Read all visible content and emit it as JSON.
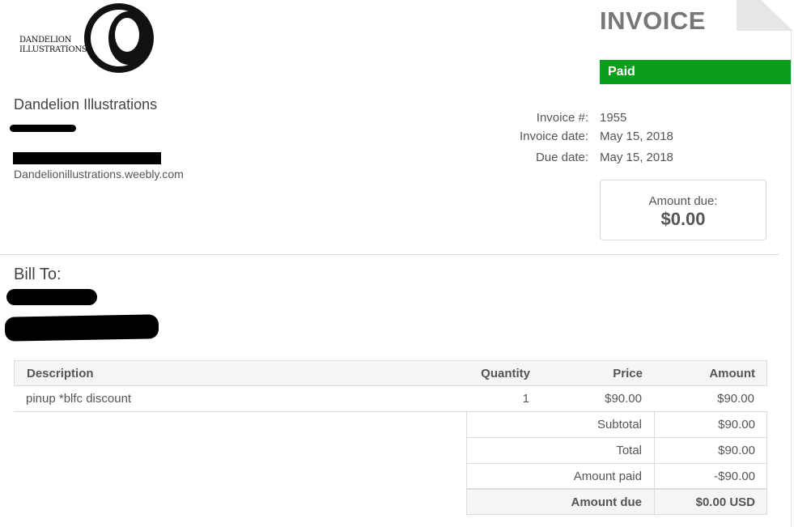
{
  "logo": {
    "line1": "DANDELION",
    "line2": "ILLUSTRATIONS"
  },
  "invoice": {
    "title": "INVOICE",
    "status": "Paid"
  },
  "company": {
    "name": "Dandelion Illustrations",
    "website": "Dandelionillustrations.weebly.com"
  },
  "meta": [
    {
      "label": "Invoice #:",
      "value": "1955"
    },
    {
      "label": "Invoice date:",
      "value": "May 15, 2018"
    },
    {
      "label": "Due date:",
      "value": "May 15, 2018"
    }
  ],
  "amount_due_box": {
    "label": "Amount due:",
    "value": "$0.00"
  },
  "bill_to": {
    "label": "Bill To:"
  },
  "table": {
    "headers": {
      "description": "Description",
      "quantity": "Quantity",
      "price": "Price",
      "amount": "Amount"
    },
    "items": [
      {
        "description": "pinup *blfc discount",
        "quantity": "1",
        "price": "$90.00",
        "amount": "$90.00"
      }
    ]
  },
  "summary": [
    {
      "label": "Subtotal",
      "value": "$90.00"
    },
    {
      "label": "Total",
      "value": "$90.00"
    },
    {
      "label": "Amount paid",
      "value": "-$90.00"
    },
    {
      "label": "Amount due",
      "value": "$0.00 USD"
    }
  ],
  "colors": {
    "paid": "#0a9e1a",
    "text": "#555555",
    "title": "#777777"
  }
}
